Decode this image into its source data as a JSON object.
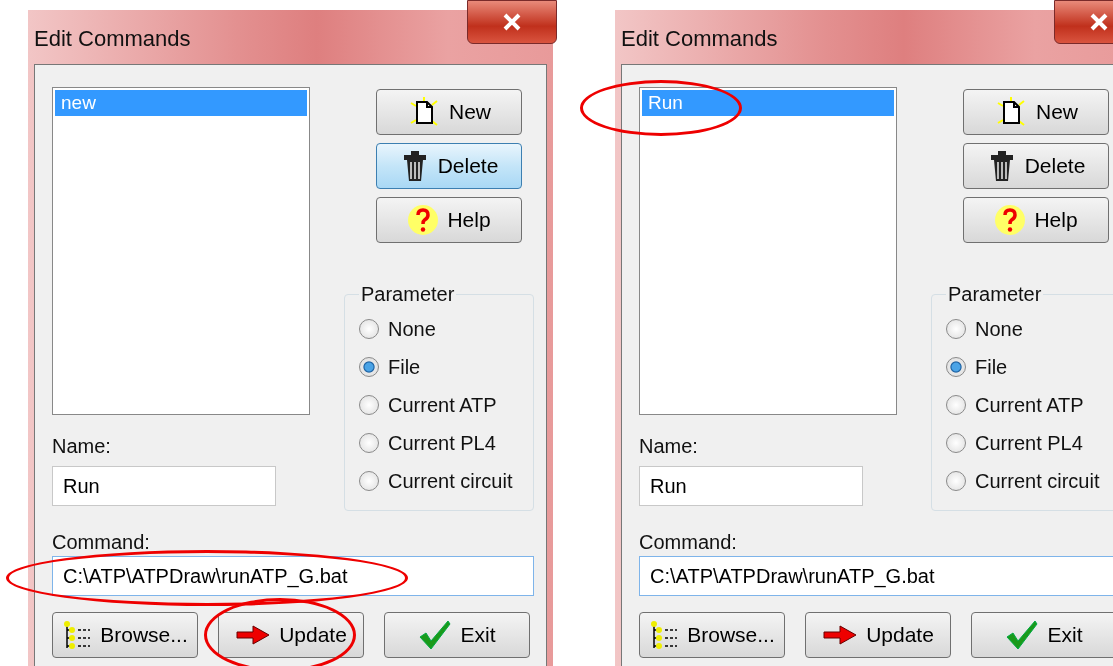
{
  "dialogs": [
    {
      "title": "Edit Commands",
      "commands": [
        {
          "label": "new",
          "selected": true,
          "circled": false
        }
      ],
      "buttons": [
        {
          "kind": "new",
          "label": "New",
          "hovered": false
        },
        {
          "kind": "delete",
          "label": "Delete",
          "hovered": true
        },
        {
          "kind": "help",
          "label": "Help",
          "hovered": false
        }
      ],
      "parameter": {
        "title": "Parameter",
        "options": [
          {
            "label": "None",
            "selected": false
          },
          {
            "label": "File",
            "selected": true
          },
          {
            "label": "Current ATP",
            "selected": false
          },
          {
            "label": "Current PL4",
            "selected": false
          },
          {
            "label": "Current circuit",
            "selected": false
          }
        ]
      },
      "name": {
        "label": "Name:",
        "value": "Run"
      },
      "command": {
        "label": "Command:",
        "value": "C:\\ATP\\ATPDraw\\runATP_G.bat",
        "circled": true
      },
      "actions": [
        {
          "kind": "browse",
          "label": "Browse...",
          "circled": false
        },
        {
          "kind": "update",
          "label": "Update",
          "circled": true
        },
        {
          "kind": "exit",
          "label": "Exit",
          "circled": false
        }
      ]
    },
    {
      "title": "Edit Commands",
      "commands": [
        {
          "label": "Run",
          "selected": true,
          "circled": true
        }
      ],
      "buttons": [
        {
          "kind": "new",
          "label": "New",
          "hovered": false
        },
        {
          "kind": "delete",
          "label": "Delete",
          "hovered": false
        },
        {
          "kind": "help",
          "label": "Help",
          "hovered": false
        }
      ],
      "parameter": {
        "title": "Parameter",
        "options": [
          {
            "label": "None",
            "selected": false
          },
          {
            "label": "File",
            "selected": true
          },
          {
            "label": "Current ATP",
            "selected": false
          },
          {
            "label": "Current PL4",
            "selected": false
          },
          {
            "label": "Current circuit",
            "selected": false
          }
        ]
      },
      "name": {
        "label": "Name:",
        "value": "Run"
      },
      "command": {
        "label": "Command:",
        "value": "C:\\ATP\\ATPDraw\\runATP_G.bat",
        "circled": false
      },
      "actions": [
        {
          "kind": "browse",
          "label": "Browse...",
          "circled": false
        },
        {
          "kind": "update",
          "label": "Update",
          "circled": false
        },
        {
          "kind": "exit",
          "label": "Exit",
          "circled": false
        }
      ]
    }
  ]
}
